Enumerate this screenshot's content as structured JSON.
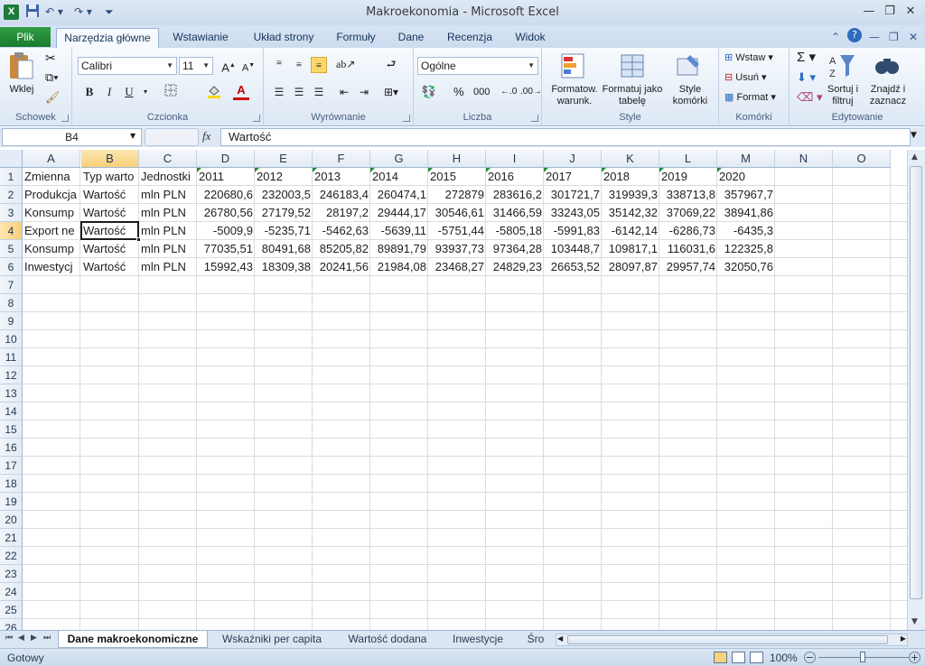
{
  "window": {
    "title": "Makroekonomia - Microsoft Excel",
    "app_icon": "X"
  },
  "ribbon_tabs": {
    "file": "Plik",
    "tabs": [
      "Narzędzia główne",
      "Wstawianie",
      "Układ strony",
      "Formuły",
      "Dane",
      "Recenzja",
      "Widok"
    ],
    "active_index": 0
  },
  "groups": {
    "clipboard": {
      "label": "Schowek",
      "paste": "Wklej"
    },
    "font": {
      "label": "Czcionka",
      "font_name": "Calibri",
      "font_size": "11"
    },
    "alignment": {
      "label": "Wyrównanie"
    },
    "number": {
      "label": "Liczba",
      "format": "Ogólne",
      "percent": "%",
      "thousands": "000"
    },
    "styles": {
      "label": "Style",
      "conditional": "Formatow. warunk.",
      "as_table": "Formatuj jako tabelę",
      "cell_styles": "Style komórki"
    },
    "cells": {
      "label": "Komórki",
      "insert": "Wstaw",
      "delete": "Usuń",
      "format": "Format"
    },
    "editing": {
      "label": "Edytowanie",
      "sort": "Sortuj i filtruj",
      "find": "Znajdź i zaznacz"
    }
  },
  "formula_bar": {
    "name_box": "B4",
    "fx": "fx",
    "content": "Wartość"
  },
  "columns": [
    "A",
    "B",
    "C",
    "D",
    "E",
    "F",
    "G",
    "H",
    "I",
    "J",
    "K",
    "L",
    "M",
    "N",
    "O"
  ],
  "rows": [
    "1",
    "2",
    "3",
    "4",
    "5",
    "6",
    "7",
    "8",
    "9",
    "10",
    "11",
    "12",
    "13",
    "14",
    "15",
    "16",
    "17",
    "18",
    "19",
    "20",
    "21",
    "22",
    "23",
    "24",
    "25",
    "26"
  ],
  "cells": {
    "header": [
      "Zmienna",
      "Typ warto",
      "Jednostki",
      "2011",
      "2012",
      "2013",
      "2014",
      "2015",
      "2016",
      "2017",
      "2018",
      "2019",
      "2020"
    ],
    "data": [
      [
        "Produkcja",
        "Wartość",
        "mln PLN",
        "220680,6",
        "232003,5",
        "246183,4",
        "260474,1",
        "272879",
        "283616,2",
        "301721,7",
        "319939,3",
        "338713,8",
        "357967,7"
      ],
      [
        "Konsump",
        "Wartość",
        "mln PLN",
        "26780,56",
        "27179,52",
        "28197,2",
        "29444,17",
        "30546,61",
        "31466,59",
        "33243,05",
        "35142,32",
        "37069,22",
        "38941,86"
      ],
      [
        "Export ne",
        "Wartość",
        "mln PLN",
        "-5009,9",
        "-5235,71",
        "-5462,63",
        "-5639,11",
        "-5751,44",
        "-5805,18",
        "-5991,83",
        "-6142,14",
        "-6286,73",
        "-6435,3"
      ],
      [
        "Konsump",
        "Wartość",
        "mln PLN",
        "77035,51",
        "80491,68",
        "85205,82",
        "89891,79",
        "93937,73",
        "97364,28",
        "103448,7",
        "109817,1",
        "116031,6",
        "122325,8"
      ],
      [
        "Inwestycj",
        "Wartość",
        "mln PLN",
        "15992,43",
        "18309,38",
        "20241,56",
        "21984,08",
        "23468,27",
        "24829,23",
        "26653,52",
        "28097,87",
        "29957,74",
        "32050,76"
      ]
    ]
  },
  "active_cell": "B4",
  "sheets": {
    "tabs": [
      "Dane makroekonomiczne",
      "Wskaźniki per capita",
      "Wartość dodana",
      "Inwestycje",
      "Śro"
    ],
    "active_index": 0
  },
  "status": {
    "ready": "Gotowy",
    "zoom": "100%"
  }
}
